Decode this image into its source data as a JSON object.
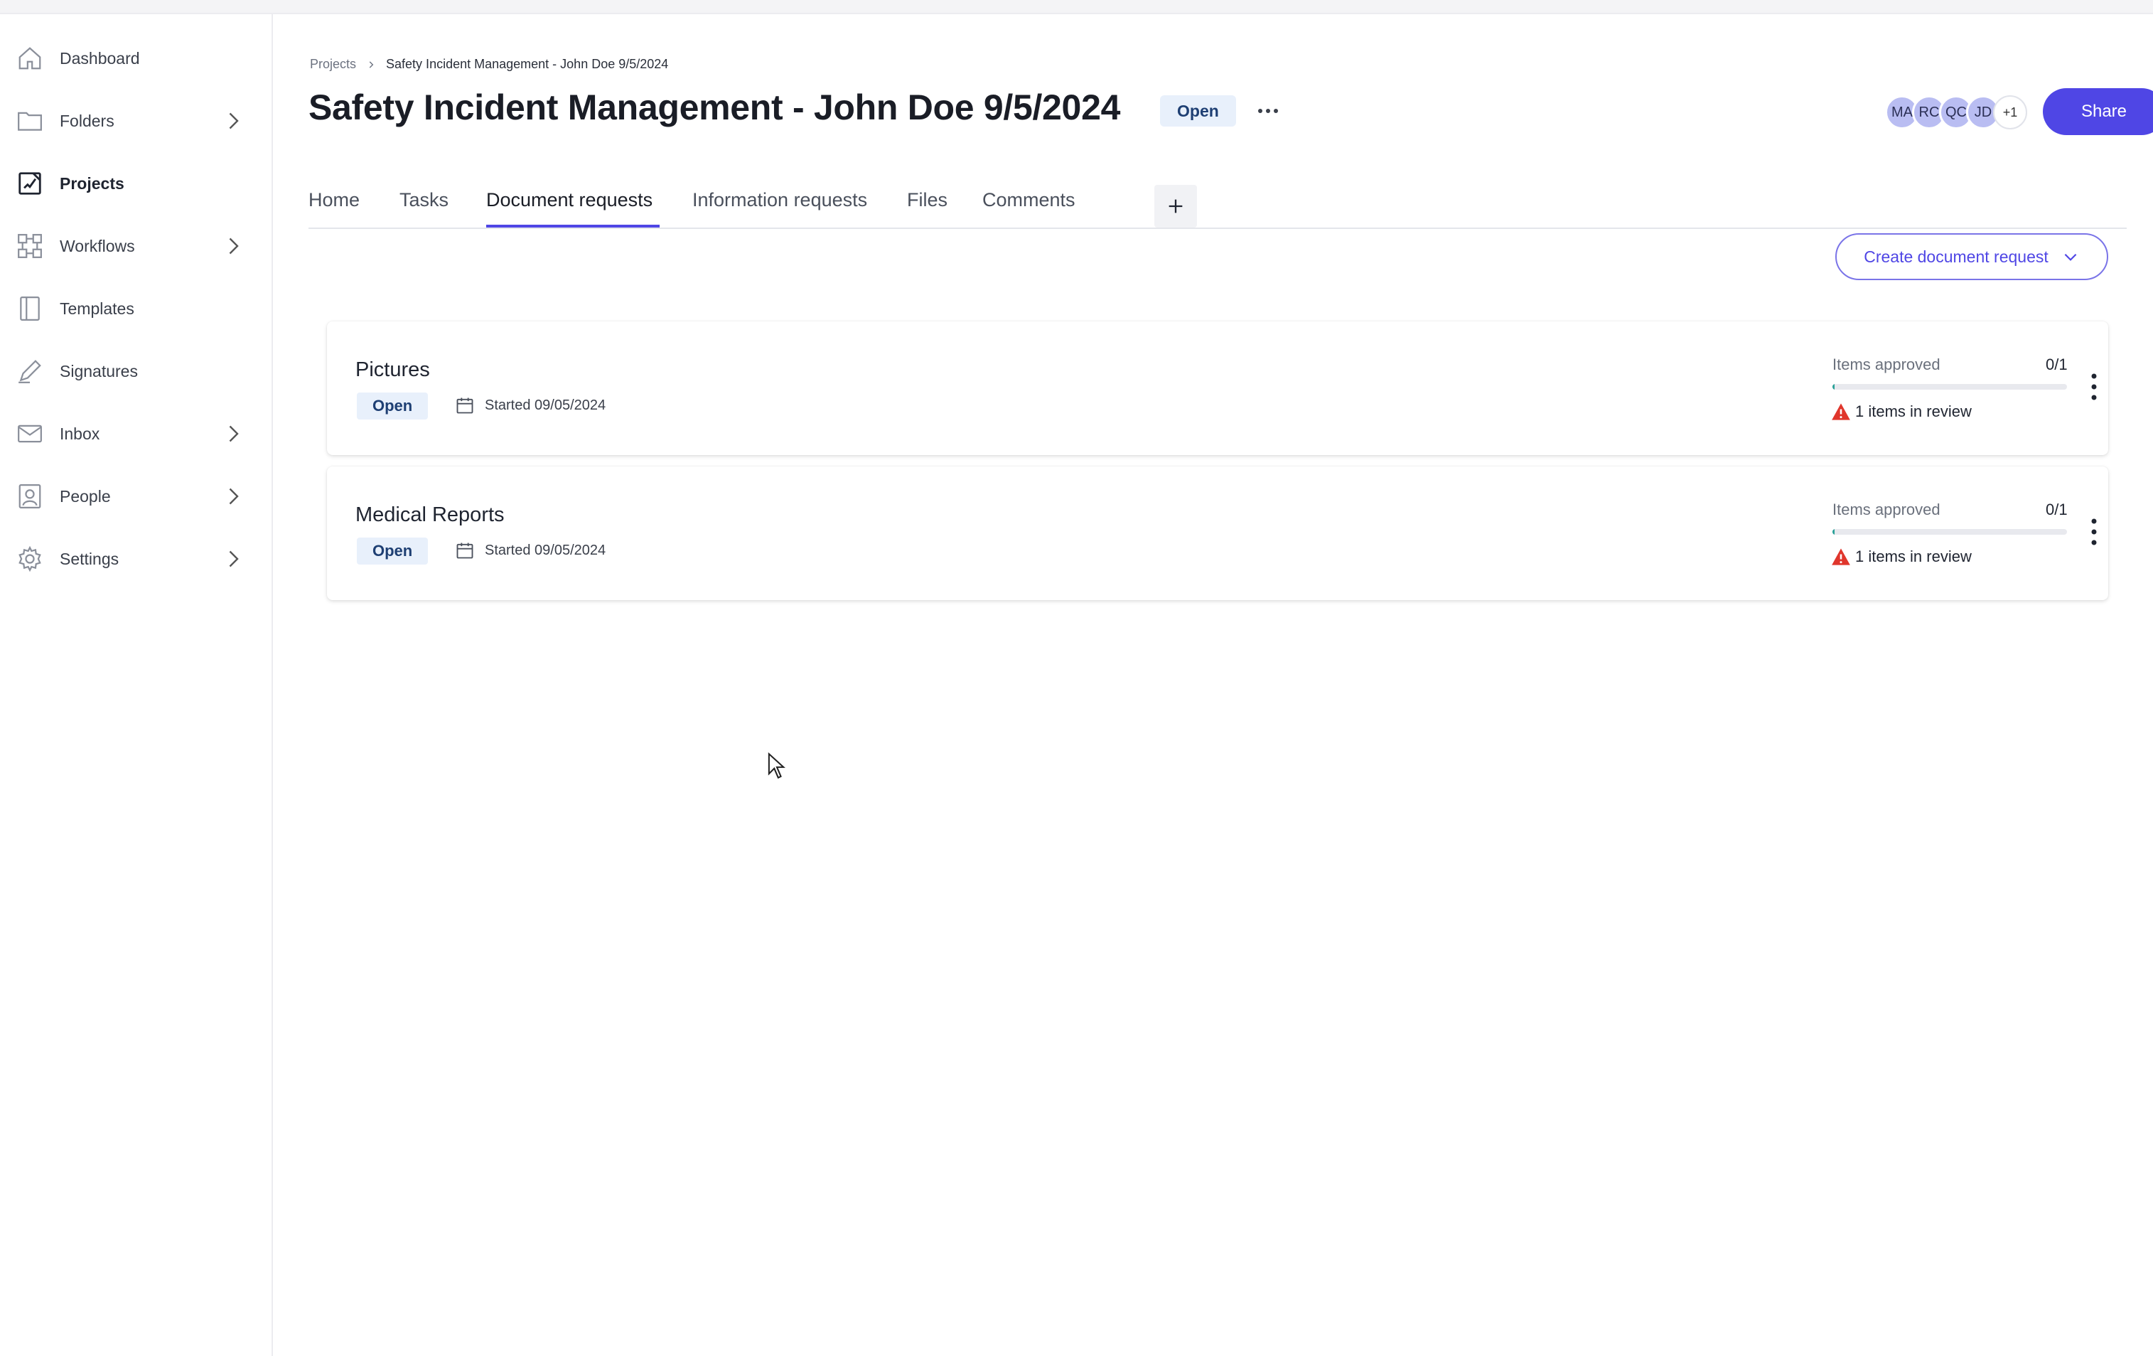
{
  "sidebar": {
    "items": [
      {
        "label": "Dashboard",
        "icon": "home-icon",
        "chevron": false,
        "active": false
      },
      {
        "label": "Folders",
        "icon": "folder-icon",
        "chevron": true,
        "active": false
      },
      {
        "label": "Projects",
        "icon": "projects-icon",
        "chevron": false,
        "active": true
      },
      {
        "label": "Workflows",
        "icon": "workflows-icon",
        "chevron": true,
        "active": false
      },
      {
        "label": "Templates",
        "icon": "templates-icon",
        "chevron": false,
        "active": false
      },
      {
        "label": "Signatures",
        "icon": "signature-icon",
        "chevron": false,
        "active": false
      },
      {
        "label": "Inbox",
        "icon": "mail-icon",
        "chevron": true,
        "active": false
      },
      {
        "label": "People",
        "icon": "person-icon",
        "chevron": true,
        "active": false
      },
      {
        "label": "Settings",
        "icon": "gear-icon",
        "chevron": true,
        "active": false
      }
    ]
  },
  "breadcrumb": {
    "root": "Projects",
    "current": "Safety Incident Management - John Doe 9/5/2024"
  },
  "header": {
    "title": "Safety Incident Management - John Doe 9/5/2024",
    "status": "Open",
    "avatars": [
      "MA",
      "RC",
      "QC",
      "JD"
    ],
    "avatars_more": "+1",
    "share_label": "Share"
  },
  "tabs": [
    {
      "label": "Home",
      "active": false
    },
    {
      "label": "Tasks",
      "active": false
    },
    {
      "label": "Document requests",
      "active": true
    },
    {
      "label": "Information requests",
      "active": false
    },
    {
      "label": "Files",
      "active": false
    },
    {
      "label": "Comments",
      "active": false
    }
  ],
  "create_button_label": "Create document request",
  "requests": [
    {
      "title": "Pictures",
      "status": "Open",
      "started": "Started 09/05/2024",
      "approved_label": "Items approved",
      "approved_count": "0/1",
      "approved_fraction": 0.01,
      "review_text": "1 items in review"
    },
    {
      "title": "Medical Reports",
      "status": "Open",
      "started": "Started 09/05/2024",
      "approved_label": "Items approved",
      "approved_count": "0/1",
      "approved_fraction": 0.01,
      "review_text": "1 items in review"
    }
  ],
  "colors": {
    "accent": "#4f46e5",
    "badge_bg": "#e8f0fb",
    "badge_text": "#1e3f73",
    "warning": "#e0362c",
    "progress": "#2aa198"
  }
}
